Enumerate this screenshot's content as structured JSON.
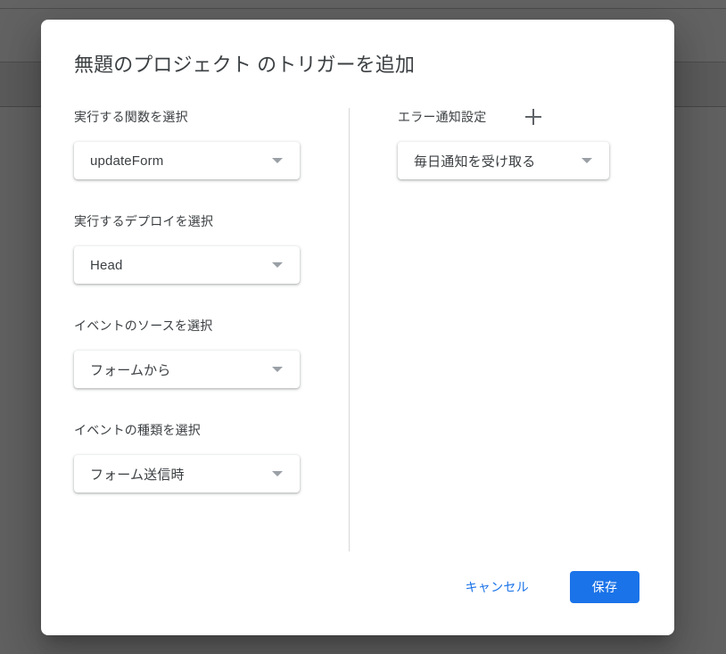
{
  "background": {
    "scrim_color": "#606060"
  },
  "dialog": {
    "title": "無題のプロジェクト のトリガーを追加",
    "left_column": {
      "fields": [
        {
          "label": "実行する関数を選択",
          "value": "updateForm",
          "caret_icon": "chevron-down-icon"
        },
        {
          "label": "実行するデプロイを選択",
          "value": "Head",
          "caret_icon": "chevron-down-icon"
        },
        {
          "label": "イベントのソースを選択",
          "value": "フォームから",
          "caret_icon": "chevron-down-icon"
        },
        {
          "label": "イベントの種類を選択",
          "value": "フォーム送信時",
          "caret_icon": "chevron-down-icon"
        }
      ]
    },
    "right_column": {
      "label": "エラー通知設定",
      "add_icon": "plus-icon",
      "value": "毎日通知を受け取る",
      "caret_icon": "chevron-down-icon"
    },
    "footer": {
      "cancel_label": "キャンセル",
      "save_label": "保存",
      "accent_color": "#1a73e8"
    }
  }
}
